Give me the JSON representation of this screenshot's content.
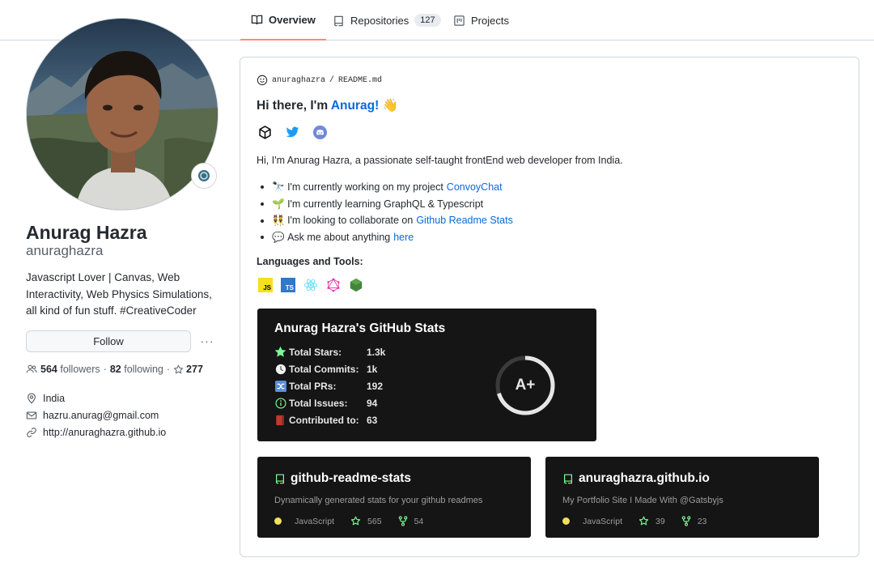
{
  "nav": {
    "tabs": [
      {
        "label": "Overview",
        "icon": "book-icon",
        "active": true
      },
      {
        "label": "Repositories",
        "icon": "repo-icon",
        "count": "127"
      },
      {
        "label": "Projects",
        "icon": "project-icon"
      }
    ]
  },
  "profile": {
    "full_name": "Anurag Hazra",
    "username": "anuraghazra",
    "bio": "Javascript Lover | Canvas, Web Interactivity, Web Physics Simulations, all kind of fun stuff. #CreativeCoder",
    "follow_label": "Follow",
    "more_label": "···",
    "followers_count": "564",
    "followers_label": "followers",
    "following_count": "82",
    "following_label": "following",
    "stars_count": "277",
    "location": "India",
    "email": "hazru.anurag@gmail.com",
    "website": "http://anuraghazra.github.io"
  },
  "readme": {
    "path_user": "anuraghazra",
    "path_sep": "/",
    "path_file": "README.md",
    "greeting_prefix": "Hi there, I'm ",
    "greeting_name": "Anurag!",
    "greeting_emoji": "👋",
    "social_icons": [
      "codesandbox-icon",
      "twitter-icon",
      "discord-icon"
    ],
    "intro": "Hi, I'm Anurag Hazra, a passionate self-taught frontEnd web developer from India.",
    "bullets": [
      {
        "emoji": "🔭",
        "text": "I'm currently working on my project",
        "link": "ConvoyChat"
      },
      {
        "emoji": "🌱",
        "text": "I'm currently learning GraphQL & Typescript",
        "link": ""
      },
      {
        "emoji": "👯",
        "text": "I'm looking to collaborate on",
        "link": "Github Readme Stats"
      },
      {
        "emoji": "💬",
        "text": "Ask me about anything",
        "link": "here"
      }
    ],
    "tools_title": "Languages and Tools:",
    "tools": [
      {
        "name": "javascript-icon",
        "label": "JS",
        "color": "#f7df1e"
      },
      {
        "name": "typescript-icon",
        "label": "TS",
        "color": "#3178c6"
      },
      {
        "name": "react-icon",
        "color": "#61dafb"
      },
      {
        "name": "graphql-icon",
        "color": "#e535ab"
      },
      {
        "name": "nodejs-icon",
        "color": "#43853d"
      }
    ]
  },
  "stats": {
    "title": "Anurag Hazra's GitHub Stats",
    "rank": "A+",
    "rows": [
      {
        "label": "Total Stars:",
        "value": "1.3k",
        "icon": "star-icon"
      },
      {
        "label": "Total Commits:",
        "value": "1k",
        "icon": "clock-icon"
      },
      {
        "label": "Total PRs:",
        "value": "192",
        "icon": "shuffle-icon"
      },
      {
        "label": "Total Issues:",
        "value": "94",
        "icon": "info-icon"
      },
      {
        "label": "Contributed to:",
        "value": "63",
        "icon": "book-red-icon"
      }
    ]
  },
  "repos": [
    {
      "name": "github-readme-stats",
      "description": "Dynamically generated stats for your github readmes",
      "language": "JavaScript",
      "language_color": "#f1e05a",
      "stars": "565",
      "forks": "54"
    },
    {
      "name": "anuraghazra.github.io",
      "description": "My Portfolio Site I Made With @Gatsbyjs",
      "language": "JavaScript",
      "language_color": "#f1e05a",
      "stars": "39",
      "forks": "23"
    }
  ],
  "colors": {
    "accent": "#0969da",
    "tab_underline": "#fd8c73",
    "card_bg": "#151515",
    "green": "#79ff97"
  }
}
